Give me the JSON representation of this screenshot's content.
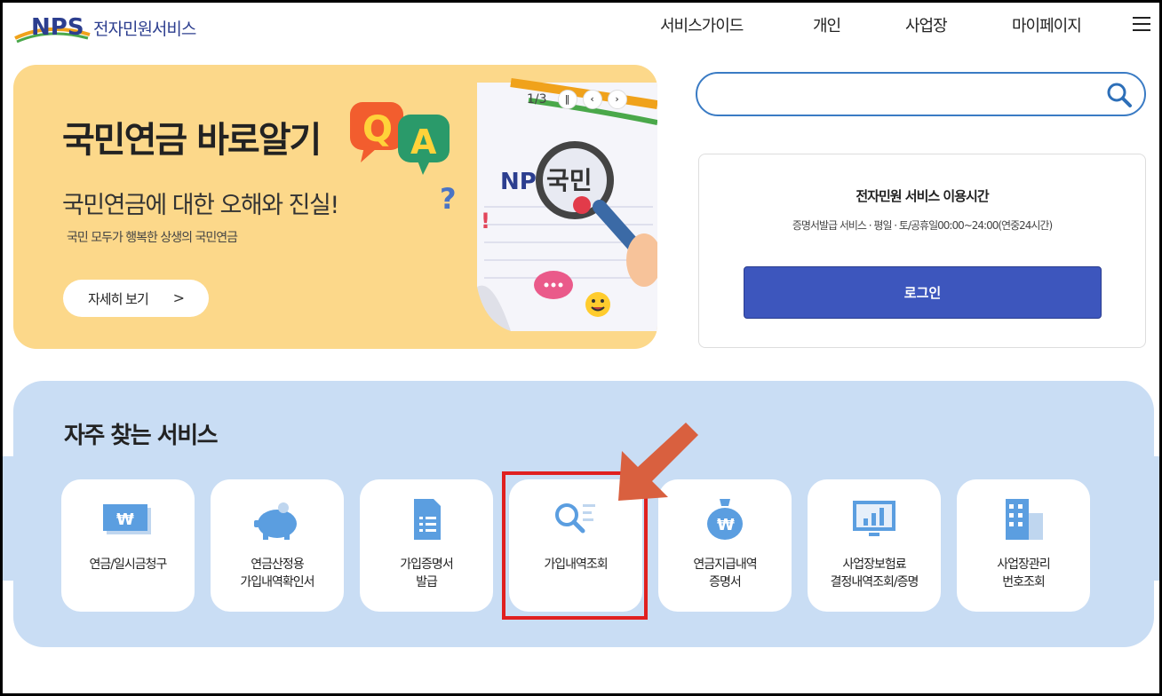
{
  "header": {
    "logo_text": "전자민원서비스",
    "nav": [
      "서비스가이드",
      "개인",
      "사업장",
      "마이페이지"
    ]
  },
  "banner": {
    "title": "국민연금 바로알기",
    "subtitle": "국민연금에 대한 오해와 진실!",
    "small": "국민 모두가 행복한 상생의 국민연금",
    "button_label": "자세히 보기",
    "slide_counter": "1/3"
  },
  "search": {
    "placeholder": ""
  },
  "login_card": {
    "title": "전자민원 서비스 이용시간",
    "description": "증명서발급 서비스 · 평일 · 토/공휴일00:00~24:00(연중24시간)",
    "login_label": "로그인"
  },
  "services": {
    "title": "자주 찾는 서비스",
    "items": [
      {
        "label_1": "연금/일시금청구",
        "label_2": ""
      },
      {
        "label_1": "연금산정용",
        "label_2": "가입내역확인서"
      },
      {
        "label_1": "가입증명서",
        "label_2": "발급"
      },
      {
        "label_1": "가입내역조회",
        "label_2": ""
      },
      {
        "label_1": "연금지급내역",
        "label_2": "증명서"
      },
      {
        "label_1": "사업장보험료",
        "label_2": "결정내역조회/증명"
      },
      {
        "label_1": "사업장관리",
        "label_2": "번호조회"
      }
    ]
  },
  "colors": {
    "brand_blue": "#2c3e8f",
    "login_button": "#3d56bd",
    "banner_bg": "#fcd88a",
    "service_bg": "#c9ddf4",
    "highlight": "#e02020",
    "arrow": "#d9603f"
  }
}
